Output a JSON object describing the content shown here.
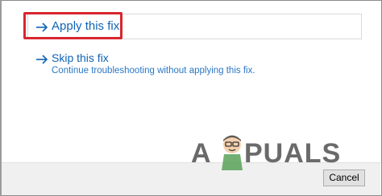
{
  "options": [
    {
      "label": "Apply this fix",
      "icon": "arrow-right-icon"
    },
    {
      "label": "Skip this fix",
      "description": "Continue troubleshooting without applying this fix.",
      "icon": "arrow-right-icon"
    }
  ],
  "footer": {
    "cancel_label": "Cancel"
  },
  "watermark": {
    "text_left": "A",
    "text_right": "PUALS"
  },
  "colors": {
    "link_blue": "#0f63b5",
    "highlight_red": "#d8262e",
    "footer_bg": "#f0f0f0"
  }
}
